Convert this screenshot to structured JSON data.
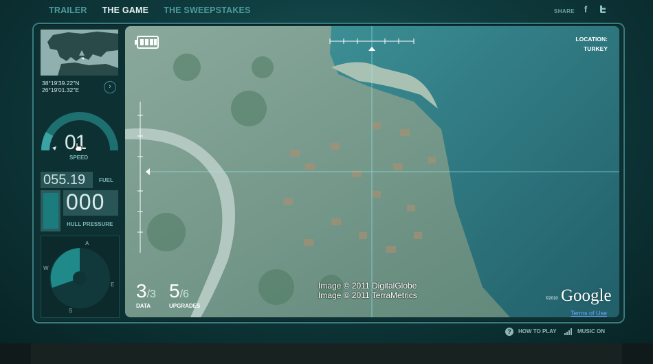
{
  "nav": {
    "items": [
      {
        "label": "TRAILER",
        "active": false
      },
      {
        "label": "THE GAME",
        "active": true
      },
      {
        "label": "THE SWEEPSTAKES",
        "active": false
      }
    ],
    "share_label": "SHARE",
    "facebook_glyph": "f",
    "twitter_glyph": "t"
  },
  "panel": {
    "coords": {
      "lat": "38°19'39.22\"N",
      "lon": "26°19'01.32\"E"
    },
    "coord_button_glyph": "›",
    "speed": {
      "value": "01",
      "label": "SPEED"
    },
    "fuel": {
      "value": "055.19",
      "label": "FUEL"
    },
    "hull": {
      "value": "000",
      "label": "HULL PRESSURE"
    },
    "compass": {
      "n": "A",
      "e": "E",
      "s": "S",
      "w": "W"
    }
  },
  "viewport": {
    "location_label": "LOCATION:",
    "location_value": "TURKEY",
    "data_count": "3",
    "data_total": "/3",
    "data_label": "DATA",
    "upgrade_count": "5",
    "upgrade_total": "/6",
    "upgrade_label": "UPGRADES",
    "credit_line1": "Image © 2011 DigitalGlobe",
    "credit_line2": "Image © 2011 TerraMetrics",
    "google_copyright": "©2010",
    "google_logo": "Google",
    "terms_link": "Terms of Use"
  },
  "footer": {
    "how_to_play": "HOW TO PLAY",
    "how_icon_glyph": "?",
    "music": "MUSIC ON"
  },
  "colors": {
    "accent": "#1a7c7c",
    "active_nav": "#e6f3f2",
    "inactive_nav": "#4e9a9c"
  }
}
